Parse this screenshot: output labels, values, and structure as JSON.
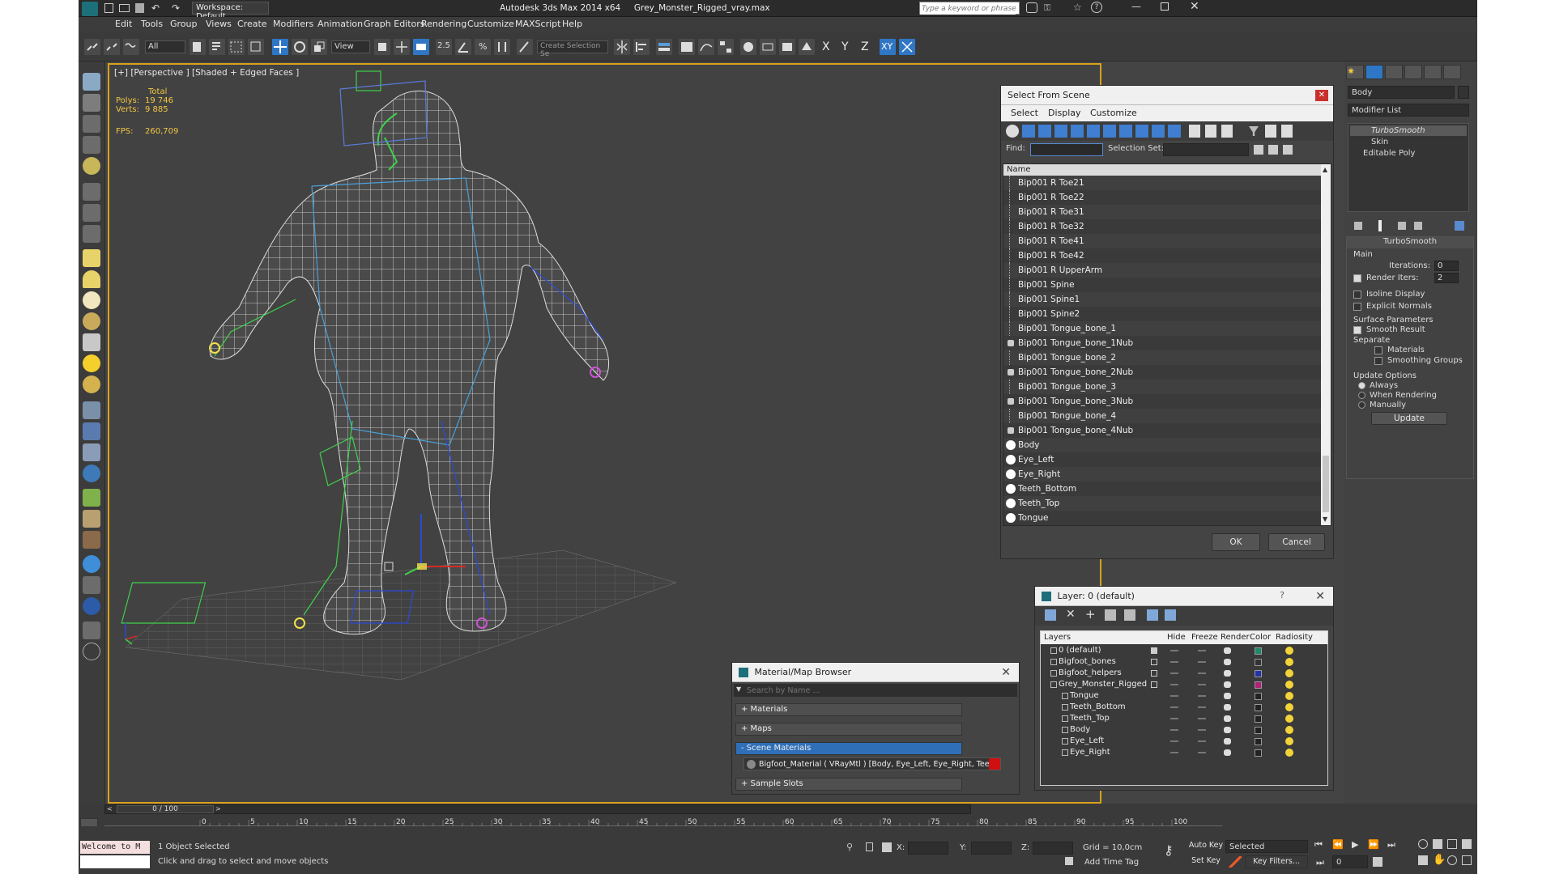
{
  "title": {
    "app": "Autodesk 3ds Max  2014 x64",
    "file": "Grey_Monster_Rigged_vray.max",
    "workspace": "Workspace: Default",
    "search_placeholder": "Type a keyword or phrase"
  },
  "menu": [
    "Edit",
    "Tools",
    "Group",
    "Views",
    "Create",
    "Modifiers",
    "Animation",
    "Graph Editors",
    "Rendering",
    "Customize",
    "MAXScript",
    "Help"
  ],
  "toolbar": {
    "filter": "All",
    "ref_coord": "View",
    "snap_angle": "2.5",
    "snap_percent": "%",
    "named_selection": "Create Selection Se",
    "axis_x": "X",
    "axis_y": "Y",
    "axis_z": "Z",
    "axis_xy": "XY"
  },
  "viewport": {
    "label": "[+] [Perspective ] [Shaded + Edged Faces ]",
    "stats_total": "Total",
    "polys_label": "Polys:",
    "polys_value": "19 746",
    "verts_label": "Verts:",
    "verts_value": "9 885",
    "fps_label": "FPS:",
    "fps_value": "260,709"
  },
  "select_from_scene": {
    "title": "Select From Scene",
    "menu": [
      "Select",
      "Display",
      "Customize"
    ],
    "find_label": "Find:",
    "selection_set_label": "Selection Set:",
    "column_name": "Name",
    "items": [
      {
        "name": "Bip001 R Toe21",
        "kind": "bone"
      },
      {
        "name": "Bip001 R Toe22",
        "kind": "bone"
      },
      {
        "name": "Bip001 R Toe31",
        "kind": "bone"
      },
      {
        "name": "Bip001 R Toe32",
        "kind": "bone"
      },
      {
        "name": "Bip001 R Toe41",
        "kind": "bone"
      },
      {
        "name": "Bip001 R Toe42",
        "kind": "bone"
      },
      {
        "name": "Bip001 R UpperArm",
        "kind": "bone"
      },
      {
        "name": "Bip001 Spine",
        "kind": "bone"
      },
      {
        "name": "Bip001 Spine1",
        "kind": "bone"
      },
      {
        "name": "Bip001 Spine2",
        "kind": "bone"
      },
      {
        "name": "Bip001 Tongue_bone_1",
        "kind": "bone"
      },
      {
        "name": "Bip001 Tongue_bone_1Nub",
        "kind": "nub"
      },
      {
        "name": "Bip001 Tongue_bone_2",
        "kind": "bone"
      },
      {
        "name": "Bip001 Tongue_bone_2Nub",
        "kind": "nub"
      },
      {
        "name": "Bip001 Tongue_bone_3",
        "kind": "bone"
      },
      {
        "name": "Bip001 Tongue_bone_3Nub",
        "kind": "nub"
      },
      {
        "name": "Bip001 Tongue_bone_4",
        "kind": "bone"
      },
      {
        "name": "Bip001 Tongue_bone_4Nub",
        "kind": "nub"
      },
      {
        "name": "Body",
        "kind": "geo"
      },
      {
        "name": "Eye_Left",
        "kind": "geo"
      },
      {
        "name": "Eye_Right",
        "kind": "geo"
      },
      {
        "name": "Teeth_Bottom",
        "kind": "geo"
      },
      {
        "name": "Teeth_Top",
        "kind": "geo"
      },
      {
        "name": "Tongue",
        "kind": "geo"
      }
    ],
    "ok": "OK",
    "cancel": "Cancel"
  },
  "layer_dialog": {
    "title": "Layer: 0 (default)",
    "help": "?",
    "columns": [
      "Layers",
      "Hide",
      "Freeze",
      "Render",
      "Color",
      "Radiosity"
    ],
    "rows": [
      {
        "name": "0 (default)",
        "color": "#1f8a6a",
        "indent": 0
      },
      {
        "name": "Bigfoot_bones",
        "color": "#333333",
        "indent": 0
      },
      {
        "name": "Bigfoot_helpers",
        "color": "#2233aa",
        "indent": 0
      },
      {
        "name": "Grey_Monster_Rigged",
        "color": "#b0207a",
        "indent": 0
      },
      {
        "name": "Tongue",
        "color": "#222222",
        "indent": 1
      },
      {
        "name": "Teeth_Bottom",
        "color": "#222222",
        "indent": 1
      },
      {
        "name": "Teeth_Top",
        "color": "#222222",
        "indent": 1
      },
      {
        "name": "Body",
        "color": "#222222",
        "indent": 1
      },
      {
        "name": "Eye_Left",
        "color": "#222222",
        "indent": 1
      },
      {
        "name": "Eye_Right",
        "color": "#222222",
        "indent": 1
      }
    ]
  },
  "material_browser": {
    "title": "Material/Map Browser",
    "search_placeholder": "Search by Name ...",
    "sections": [
      "+ Materials",
      "+ Maps",
      "- Scene Materials"
    ],
    "scene_material": "Bigfoot_Material  ( VRayMtl )  [Body, Eye_Left, Eye_Right, Teeth...",
    "sample_slots": "+ Sample Slots"
  },
  "command_panel": {
    "object_name": "Body",
    "modifier_list": "Modifier List",
    "stack": [
      "TurboSmooth",
      "Skin",
      "Editable Poly"
    ],
    "rollout_title": "TurboSmooth",
    "main_label": "Main",
    "iterations_label": "Iterations:",
    "iterations_value": "0",
    "render_iters_label": "Render Iters:",
    "render_iters_value": "2",
    "isoline_display": "Isoline Display",
    "explicit_normals": "Explicit Normals",
    "surface_params": "Surface Parameters",
    "smooth_result": "Smooth Result",
    "separate": "Separate",
    "materials": "Materials",
    "smoothing_groups": "Smoothing Groups",
    "update_options": "Update Options",
    "always": "Always",
    "when_rendering": "When Rendering",
    "manually": "Manually",
    "update_button": "Update"
  },
  "timeline": {
    "frame_label": "0 / 100",
    "ticks": [
      "0",
      "5",
      "10",
      "15",
      "20",
      "25",
      "30",
      "35",
      "40",
      "45",
      "50",
      "55",
      "60",
      "65",
      "70",
      "75",
      "80",
      "85",
      "90",
      "95",
      "100"
    ]
  },
  "status": {
    "maxscript": "Welcome to M",
    "selected": "1 Object Selected",
    "prompt": "Click and drag to select and move objects",
    "x_label": "X:",
    "y_label": "Y:",
    "z_label": "Z:",
    "grid": "Grid = 10,0cm",
    "add_time_tag": "Add Time Tag",
    "auto_key": "Auto Key",
    "set_key": "Set Key",
    "selected_dropdown": "Selected",
    "key_filters": "Key Filters...",
    "frame": "0"
  },
  "colors": {
    "active_viewport_border": "#d8a21b",
    "selection_blue": "#2f77c5",
    "stats_yellow": "#f2c744",
    "close_red": "#c9302c"
  }
}
